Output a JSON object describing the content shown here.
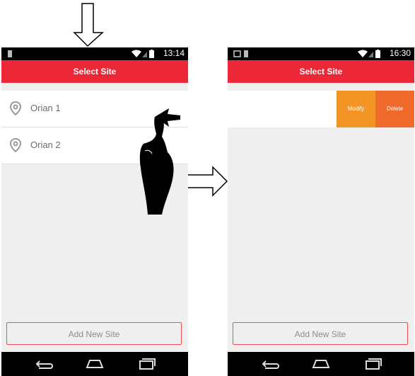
{
  "left_screen": {
    "status": {
      "time": "13:14"
    },
    "title": "Select Site",
    "sites": [
      {
        "label": "Orian 1",
        "icon": "location-pin-icon"
      },
      {
        "label": "Orian 2",
        "icon": "location-pin-icon"
      }
    ],
    "add_button": "Add New Site",
    "gesture_icon": "swipe-left-hand-icon"
  },
  "right_screen": {
    "status": {
      "time": "16:30"
    },
    "title": "Select Site",
    "row_actions": {
      "modify": "Modify",
      "delete": "Delete"
    },
    "add_button": "Add New Site"
  },
  "annotations": {
    "down_arrow_icon": "arrow-down-icon",
    "right_arrow_icon": "arrow-right-icon"
  },
  "colors": {
    "accent": "#ed2836",
    "modify": "#f29524",
    "delete": "#ef6a2b",
    "background": "#efefef"
  }
}
